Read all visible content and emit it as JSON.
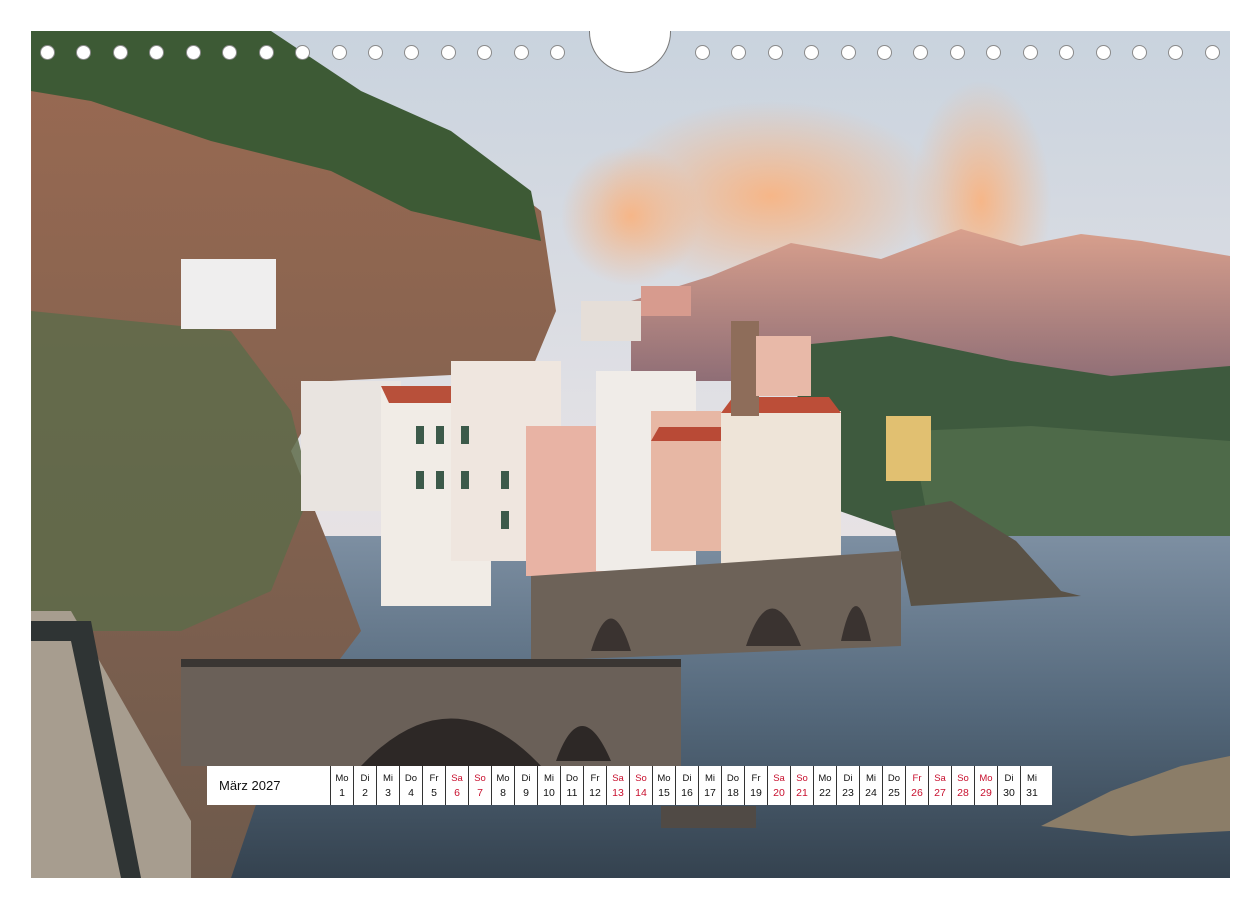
{
  "calendar": {
    "month_year": "März 2027",
    "days": [
      {
        "weekday": "Mo",
        "day": "1",
        "red": false
      },
      {
        "weekday": "Di",
        "day": "2",
        "red": false
      },
      {
        "weekday": "Mi",
        "day": "3",
        "red": false
      },
      {
        "weekday": "Do",
        "day": "4",
        "red": false
      },
      {
        "weekday": "Fr",
        "day": "5",
        "red": false
      },
      {
        "weekday": "Sa",
        "day": "6",
        "red": true
      },
      {
        "weekday": "So",
        "day": "7",
        "red": true
      },
      {
        "weekday": "Mo",
        "day": "8",
        "red": false
      },
      {
        "weekday": "Di",
        "day": "9",
        "red": false
      },
      {
        "weekday": "Mi",
        "day": "10",
        "red": false
      },
      {
        "weekday": "Do",
        "day": "11",
        "red": false
      },
      {
        "weekday": "Fr",
        "day": "12",
        "red": false
      },
      {
        "weekday": "Sa",
        "day": "13",
        "red": true
      },
      {
        "weekday": "So",
        "day": "14",
        "red": true
      },
      {
        "weekday": "Mo",
        "day": "15",
        "red": false
      },
      {
        "weekday": "Di",
        "day": "16",
        "red": false
      },
      {
        "weekday": "Mi",
        "day": "17",
        "red": false
      },
      {
        "weekday": "Do",
        "day": "18",
        "red": false
      },
      {
        "weekday": "Fr",
        "day": "19",
        "red": false
      },
      {
        "weekday": "Sa",
        "day": "20",
        "red": true
      },
      {
        "weekday": "So",
        "day": "21",
        "red": true
      },
      {
        "weekday": "Mo",
        "day": "22",
        "red": false
      },
      {
        "weekday": "Di",
        "day": "23",
        "red": false
      },
      {
        "weekday": "Mi",
        "day": "24",
        "red": false
      },
      {
        "weekday": "Do",
        "day": "25",
        "red": false
      },
      {
        "weekday": "Fr",
        "day": "26",
        "red": true
      },
      {
        "weekday": "Sa",
        "day": "27",
        "red": true
      },
      {
        "weekday": "So",
        "day": "28",
        "red": true
      },
      {
        "weekday": "Mo",
        "day": "29",
        "red": true
      },
      {
        "weekday": "Di",
        "day": "30",
        "red": false
      },
      {
        "weekday": "Mi",
        "day": "31",
        "red": false
      }
    ]
  },
  "colors": {
    "holiday_red": "#c8102e",
    "sea": "#4a5c6e",
    "sky": "#dde4ec"
  },
  "binding": {
    "hole_icon": "punch-hole-icon",
    "hanger_icon": "hanger-notch-icon"
  }
}
